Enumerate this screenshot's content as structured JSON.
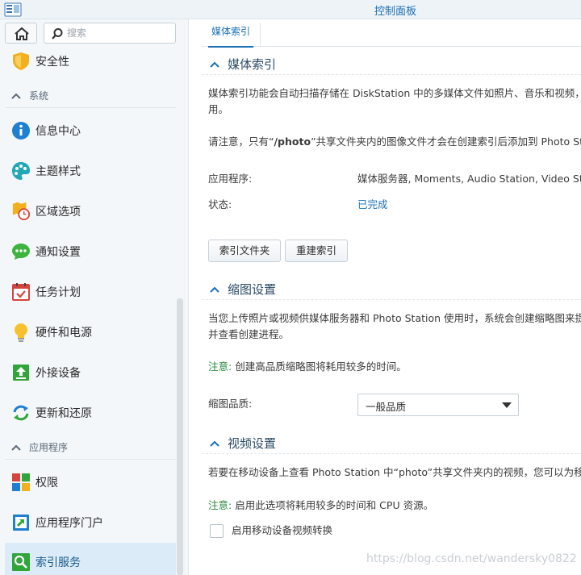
{
  "window": {
    "title": "控制面板"
  },
  "sidebar": {
    "search": {
      "placeholder": "搜索"
    },
    "items": [
      {
        "label": "安全性",
        "icon": "shield-icon"
      },
      {
        "section": "系统"
      },
      {
        "label": "信息中心",
        "icon": "info-icon"
      },
      {
        "label": "主题样式",
        "icon": "palette-icon"
      },
      {
        "label": "区域选项",
        "icon": "clock-map-icon"
      },
      {
        "label": "通知设置",
        "icon": "chat-bubble-icon"
      },
      {
        "label": "任务计划",
        "icon": "calendar-check-icon"
      },
      {
        "label": "硬件和电源",
        "icon": "lightbulb-icon"
      },
      {
        "label": "外接设备",
        "icon": "upload-icon"
      },
      {
        "label": "更新和还原",
        "icon": "refresh-icon"
      },
      {
        "section": "应用程序"
      },
      {
        "label": "权限",
        "icon": "grid-icon"
      },
      {
        "label": "应用程序门户",
        "icon": "external-link-icon"
      },
      {
        "label": "索引服务",
        "icon": "search-index-icon",
        "active": true
      }
    ],
    "labels": {
      "security": "安全性",
      "section_system": "系统",
      "info_center": "信息中心",
      "theme": "主题样式",
      "regional": "区域选项",
      "notification": "通知设置",
      "task_scheduler": "任务计划",
      "hardware_power": "硬件和电源",
      "external_devices": "外接设备",
      "update_restore": "更新和还原",
      "section_apps": "应用程序",
      "privileges": "权限",
      "app_portal": "应用程序门户",
      "indexing_service": "索引服务"
    }
  },
  "main": {
    "tab": "媒体索引",
    "media_index": {
      "title": "媒体索引",
      "desc_line1": "媒体索引功能会自动扫描存储在 DiskStation 中的多媒体文件如照片、音乐和视频，并",
      "desc_line2": "用。",
      "note_prefix": "请注意，只有“",
      "note_bold": "/photo",
      "note_suffix": "”共享文件夹内的图像文件才会在创建索引后添加到 Photo Stat",
      "app_label": "应用程序:",
      "app_value": "媒体服务器, Moments, Audio Station, Video Sta",
      "status_label": "状态:",
      "status_value": "已完成",
      "btn_index_folder": "索引文件夹",
      "btn_reindex": "重建索引"
    },
    "thumbnail": {
      "title": "缩图设置",
      "desc_line1": "当您上传照片或视频供媒体服务器和 Photo Station 使用时，系统会创建缩略图来提供",
      "desc_line2": "并查看创建进程。",
      "note_label": "注意:",
      "note_text": "创建高品质缩略图将耗用较多的时间。",
      "quality_label": "缩图品质:",
      "quality_value": "一般品质"
    },
    "video": {
      "title": "视频设置",
      "desc_line1": "若要在移动设备上查看 Photo Station 中“photo”共享文件夹内的视频，您可以为移动i",
      "note_label": "注意:",
      "note_text": "启用此选项将耗用较多的时间和 CPU 资源。",
      "checkbox_label": "启用移动设备视频转换",
      "checkbox_checked": false
    }
  },
  "watermark": "https://blog.csdn.net/wandersky0822",
  "colors": {
    "accent": "#1a6fb5",
    "note": "#2b8a3e",
    "active_bg": "#dbebf7"
  }
}
